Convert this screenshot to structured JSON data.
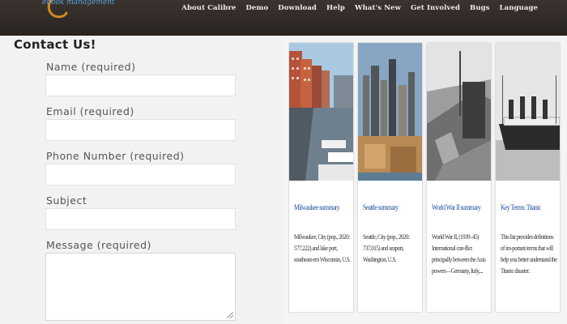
{
  "header": {
    "logo_text": "ebook management",
    "nav": [
      "About Calibre",
      "Demo",
      "Download",
      "Help",
      "What's New",
      "Get Involved",
      "Bugs",
      "Language"
    ]
  },
  "contact": {
    "title": "Contact Us!",
    "fields": [
      {
        "label": "Name (required)",
        "value": ""
      },
      {
        "label": "Email (required)",
        "value": ""
      },
      {
        "label": "Phone Number (required)",
        "value": ""
      },
      {
        "label": "Subject",
        "value": ""
      }
    ],
    "message": {
      "label": "Message (required)",
      "value": ""
    }
  },
  "cards": [
    {
      "title": "Milwaukee summary",
      "desc": "Milwaukee, City (pop., 2020: 577,222) and lake port, southeast-ern Wisconsin, U.S."
    },
    {
      "title": "Seattle summary",
      "desc": "Seattle, City (pop., 2020: 737,015) and seaport, Washington, U.S."
    },
    {
      "title": "World War II summary",
      "desc": "World War II, (1939–45) International con-flict principally between the Axis powers—Germany, Italy,..."
    },
    {
      "title": "Key Terms: Titanic",
      "desc": "This list provides definitions of im-portant terms that will help you better understand the Titanic disaster."
    }
  ],
  "colors": {
    "header_bg": "#2f2926",
    "link_blue": "#1e4fa0",
    "panel_bg": "#f2f2f2"
  }
}
